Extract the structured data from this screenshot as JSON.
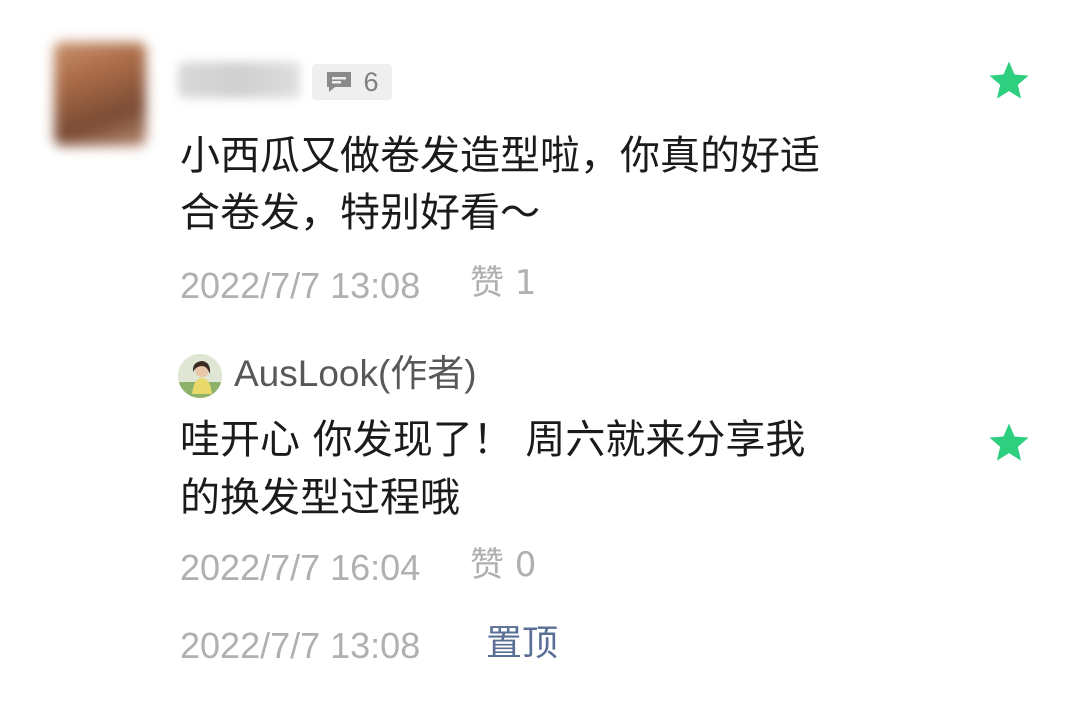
{
  "comment": {
    "reply_count": "6",
    "text_lines": [
      "小西瓜又做卷发造型啦，你真的好适",
      "合卷发，特别好看～"
    ],
    "timestamp": "2022/7/7 13:08",
    "like_label": "赞 1",
    "icon_reply": "speech-bubble-icon",
    "icon_star": "star-icon",
    "star_color": "#2ecf7f"
  },
  "reply": {
    "author": "AusLook(作者)",
    "text_lines": [
      "哇开心 你发现了！ 周六就来分享我",
      "的换发型过程哦"
    ],
    "timestamp": "2022/7/7 16:04",
    "like_label": "赞 0"
  },
  "footer": {
    "timestamp": "2022/7/7 13:08",
    "pin_label": "置顶"
  }
}
